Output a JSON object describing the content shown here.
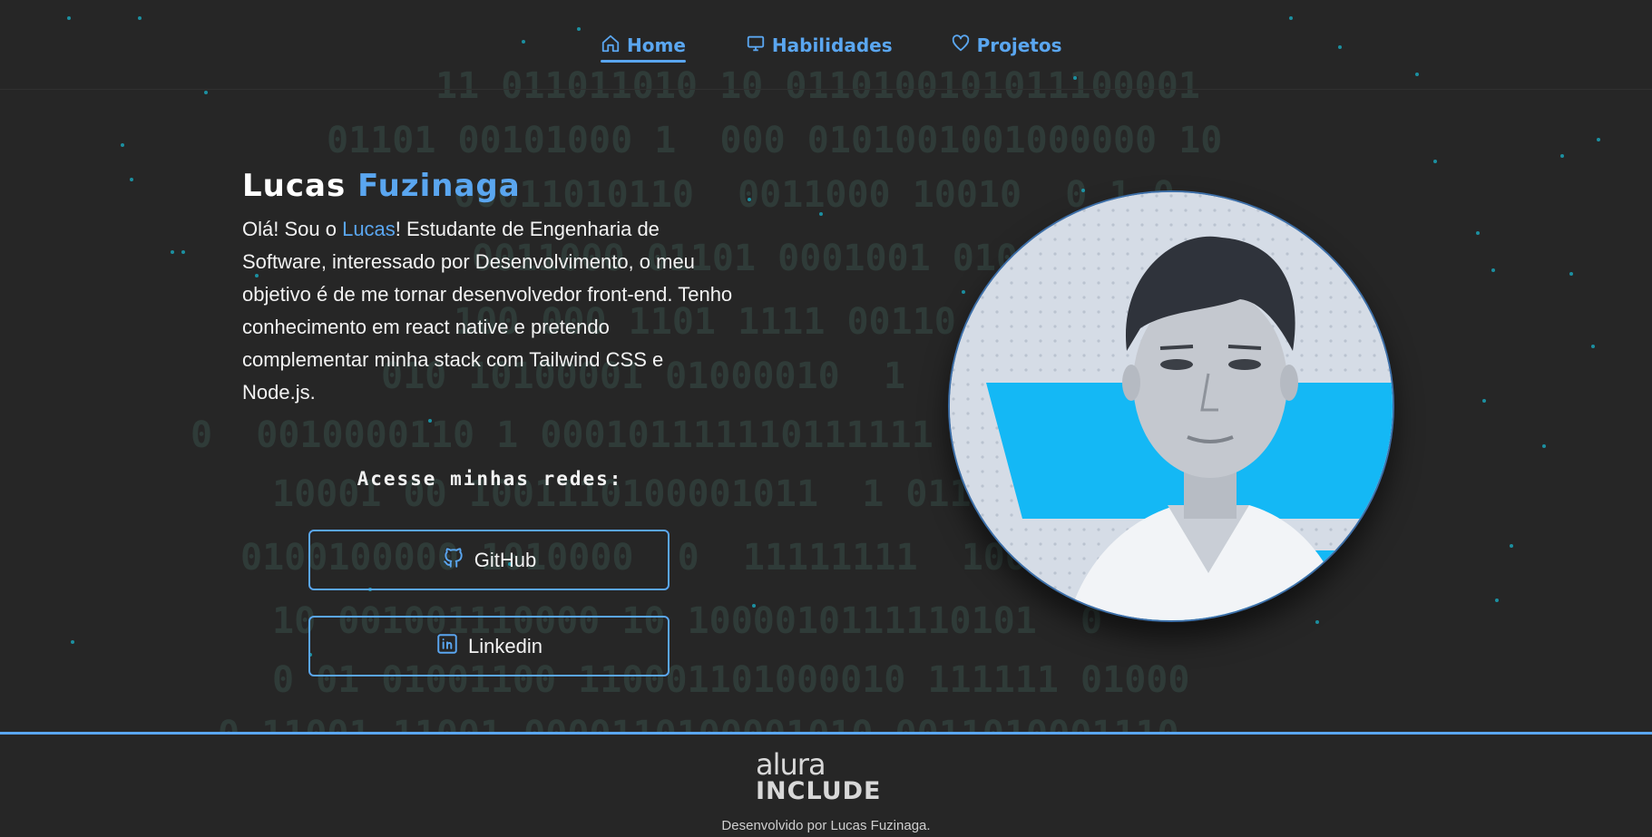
{
  "nav": {
    "items": [
      {
        "label": "Home",
        "icon": "home-icon",
        "active": true
      },
      {
        "label": "Habilidades",
        "icon": "monitor-icon",
        "active": false
      },
      {
        "label": "Projetos",
        "icon": "heart-icon",
        "active": false
      }
    ]
  },
  "intro": {
    "first_name": "Lucas",
    "last_name": "Fuzinaga",
    "bio_before": "Olá! Sou o ",
    "bio_highlight": "Lucas",
    "bio_after": "! Estudante de Engenharia de Software, interessado por Desenvolvimento, o meu objetivo é de me tornar desenvolvedor front-end. Tenho conhecimento em react native e pretendo complementar minha stack com Tailwind CSS e Node.js."
  },
  "social": {
    "title": "Acesse minhas redes:",
    "github_label": "GitHub",
    "linkedin_label": "Linkedin"
  },
  "footer": {
    "logo_top": "alura",
    "logo_bottom": "INCLUDE",
    "credit": "Desenvolvido por Lucas Fuzinaga."
  },
  "colors": {
    "accent": "#5aa6f0",
    "background": "#262626",
    "photo_band": "#14b8f5"
  }
}
